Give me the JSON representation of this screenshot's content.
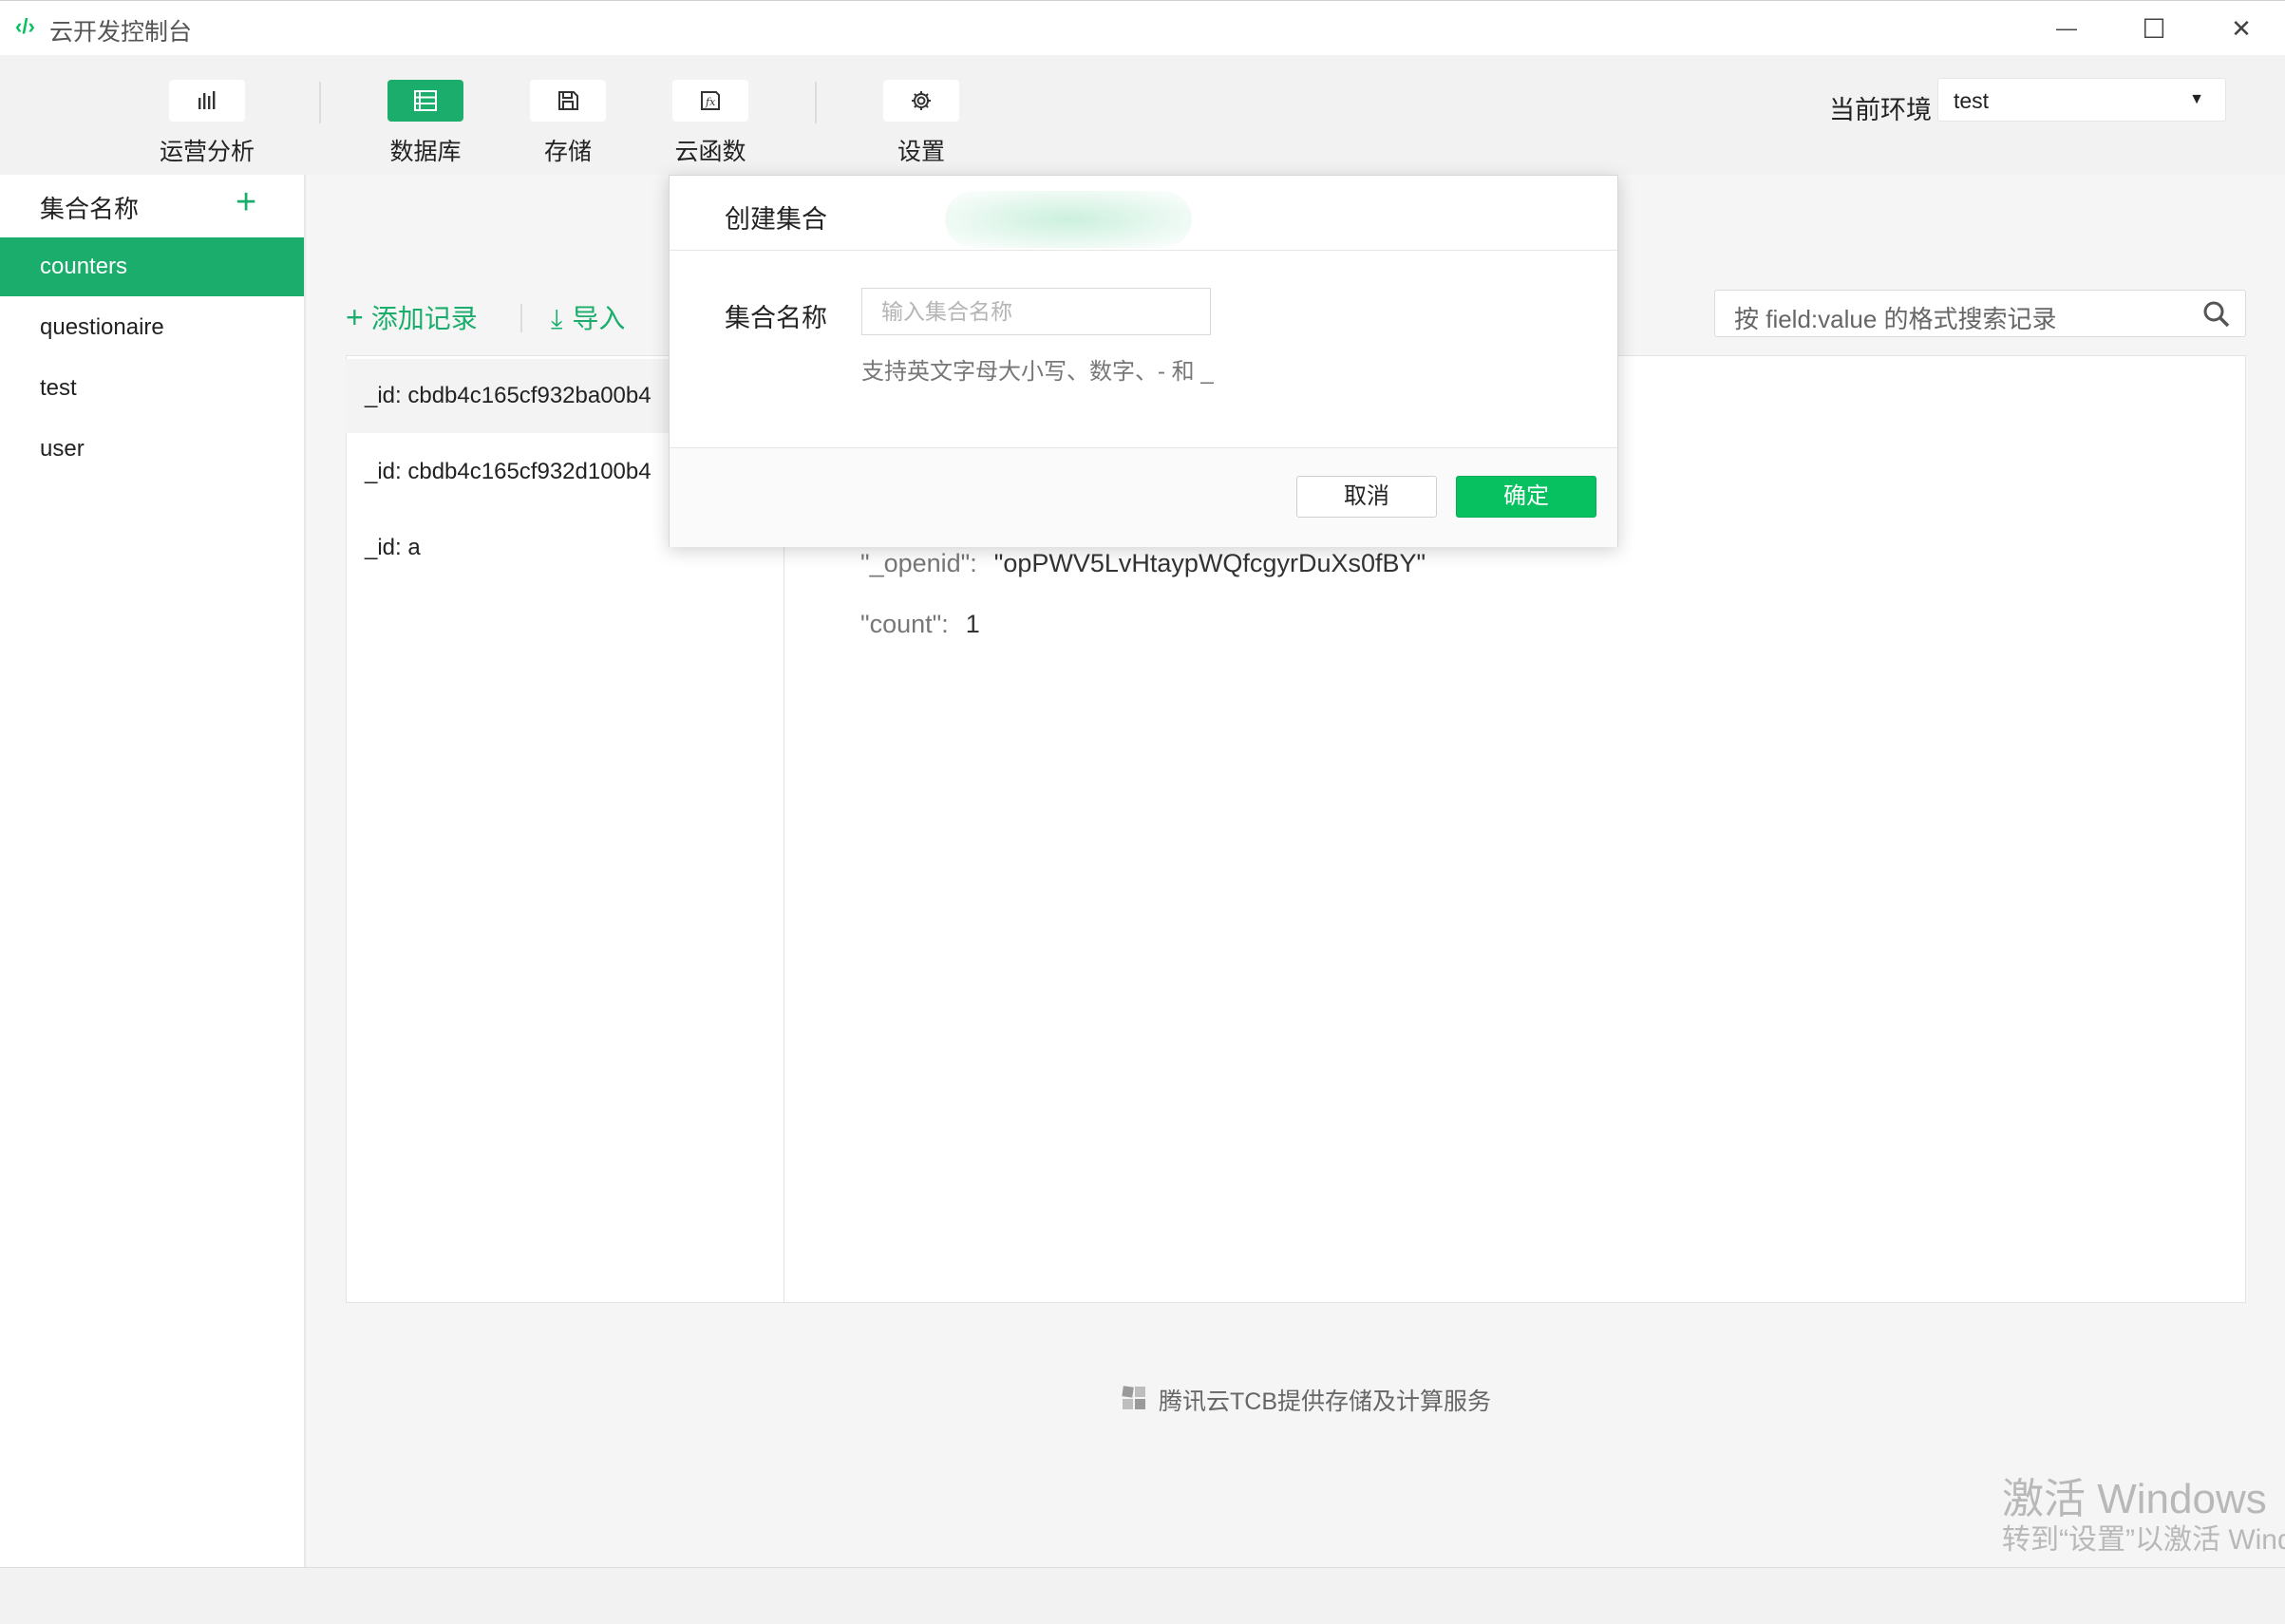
{
  "window": {
    "title": "云开发控制台",
    "logo": "‹/›",
    "minimize": "—",
    "maximize": "☐",
    "close": "✕"
  },
  "toolbar": {
    "items": [
      {
        "label": "运营分析",
        "icon": "bar-chart-icon",
        "active": false
      },
      {
        "label": "数据库",
        "icon": "database-icon",
        "active": true
      },
      {
        "label": "存储",
        "icon": "save-icon",
        "active": false
      },
      {
        "label": "云函数",
        "icon": "function-icon",
        "active": false
      },
      {
        "label": "设置",
        "icon": "gear-icon",
        "active": false
      }
    ],
    "env_label": "当前环境",
    "env_value": "test"
  },
  "sidebar": {
    "title": "集合名称",
    "add": "+",
    "items": [
      {
        "label": "counters",
        "selected": true
      },
      {
        "label": "questionaire",
        "selected": false
      },
      {
        "label": "test",
        "selected": false
      },
      {
        "label": "user",
        "selected": false
      }
    ]
  },
  "main": {
    "add_record": "添加记录",
    "import": "导入",
    "search_placeholder": "按 field:value 的格式搜索记录",
    "records": [
      {
        "label": "_id: cbdb4c165cf932ba00b4",
        "selected": true
      },
      {
        "label": "_id: cbdb4c165cf932d100b4",
        "selected": false
      },
      {
        "label": "_id: a",
        "selected": false
      }
    ],
    "detail": [
      {
        "key": "\"_openid\":",
        "value": "\"opPWV5LvHtaypWQfcgyrDuXs0fBY\""
      },
      {
        "key": "\"count\":",
        "value": "1"
      }
    ],
    "footer": "腾讯云TCB提供存储及计算服务"
  },
  "dialog": {
    "title": "创建集合",
    "field_label": "集合名称",
    "placeholder": "输入集合名称",
    "hint": "支持英文字母大小写、数字、- 和 _",
    "cancel": "取消",
    "ok": "确定"
  },
  "watermark": {
    "line1": "激活 Windows",
    "line2": "转到“设置”以激活 Windows。"
  },
  "colors": {
    "accent": "#1aad6b",
    "ok_button": "#07c160"
  }
}
